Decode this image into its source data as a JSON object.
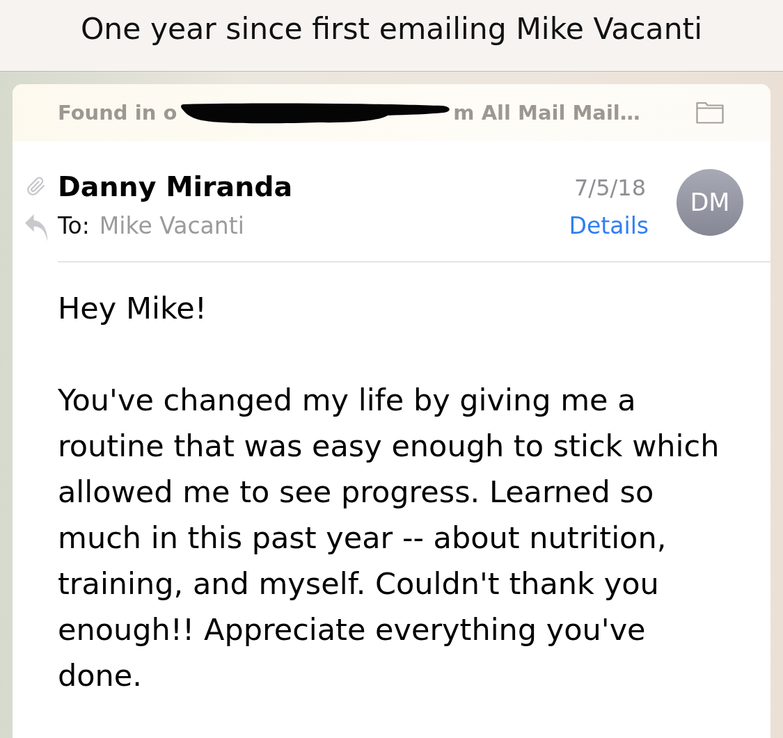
{
  "title": "One year since first emailing Mike Vacanti",
  "banner": {
    "location_start": "Found in o",
    "location_end": "m All Mail Mail…",
    "redacted": true
  },
  "message": {
    "sender": "Danny Miranda",
    "attachment": true,
    "replied": true,
    "to_label": "To:",
    "recipient": "Mike Vacanti",
    "date": "7/5/18",
    "details_link": "Details",
    "avatar_initials": "DM"
  },
  "body": [
    "Hey Mike!",
    "You've changed my life by giving me a routine that was easy enough to stick which allowed me to see progress. Learned so much in this past year -- about nutrition, training, and myself. Couldn't thank you enough!! Appreciate everything you've done."
  ]
}
